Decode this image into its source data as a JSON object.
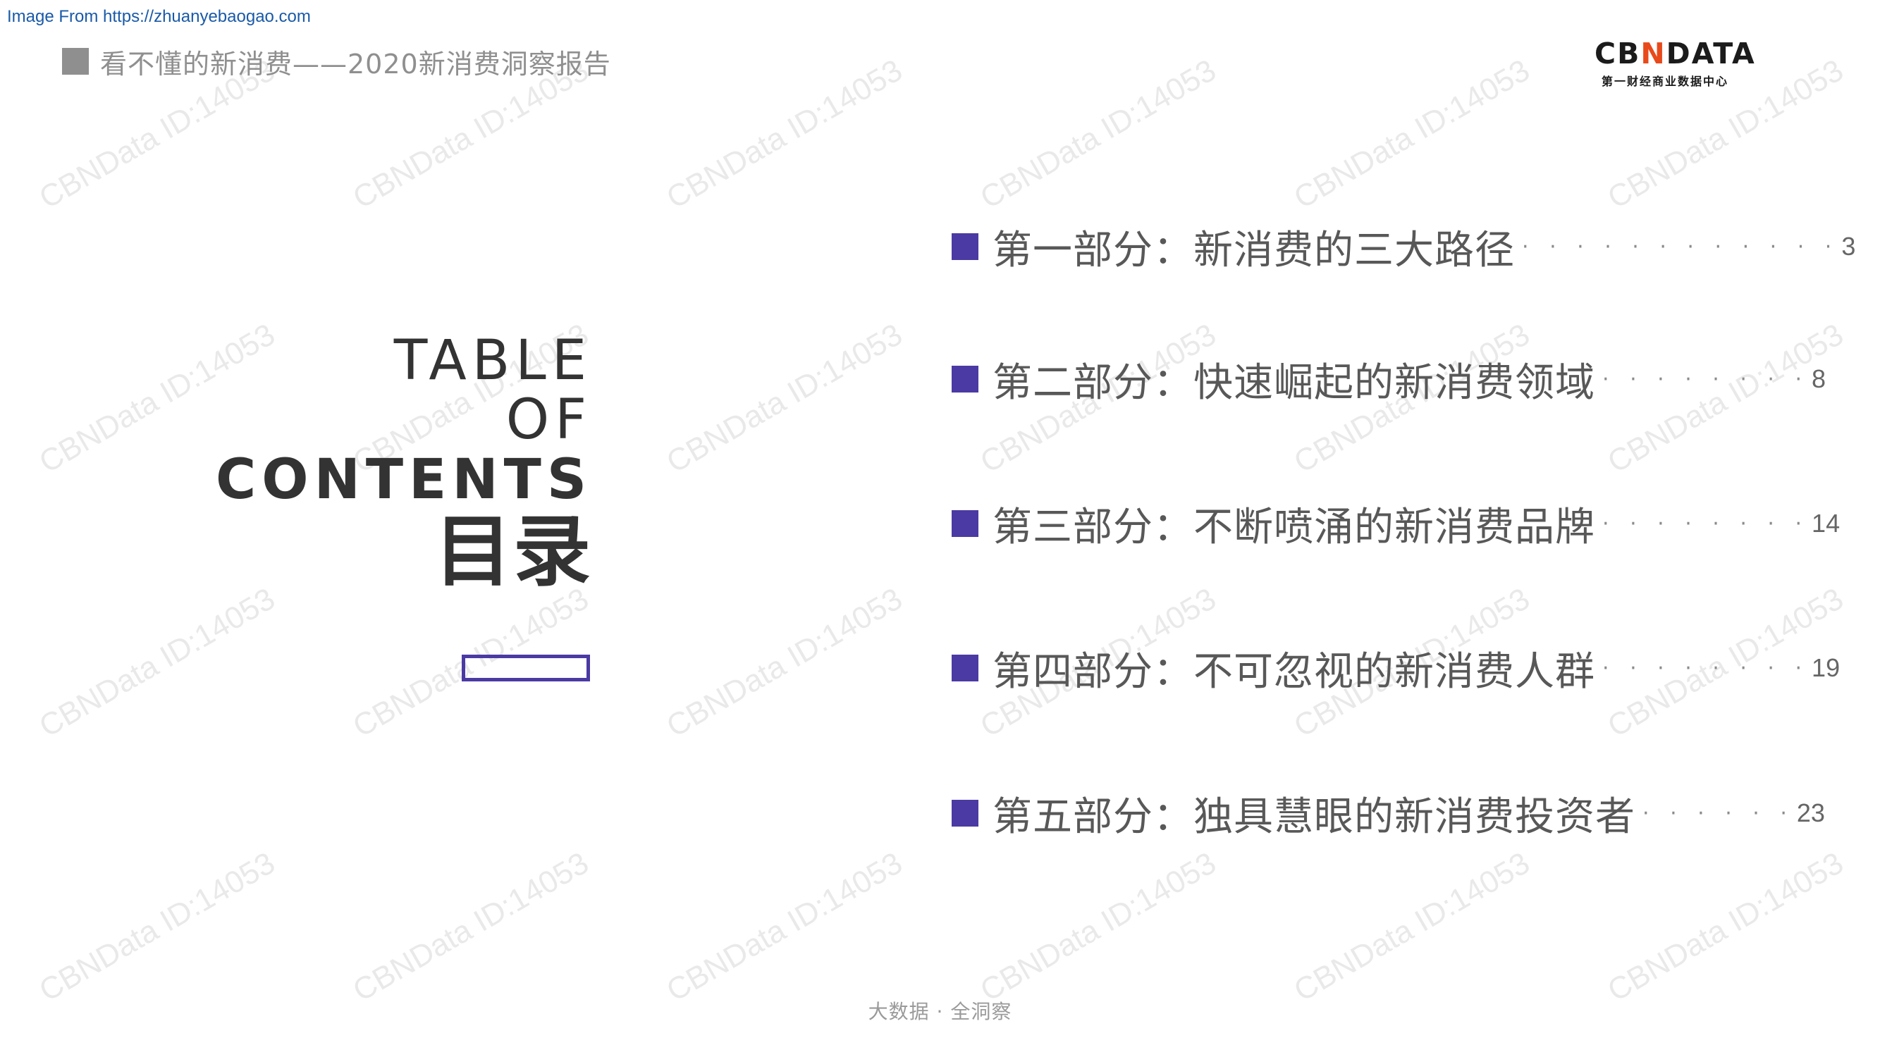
{
  "source_link": "Image From https://zhuanyebaogao.com",
  "header": {
    "title": "看不懂的新消费——2020新消费洞察报告"
  },
  "logo": {
    "main_pre": "CB",
    "main_n": "N",
    "main_post": "DATA",
    "sub": "第一财经商业数据中心"
  },
  "toc_heading": {
    "line1": "TABLE",
    "line2": "OF",
    "line3": "CONTENTS",
    "line4": "目录"
  },
  "toc_items": [
    {
      "label": "第一部分：新消费的三大路径",
      "dots": "· · · · · · · · · · · ·",
      "page": "3"
    },
    {
      "label": "第二部分：快速崛起的新消费领域",
      "dots": "· · · · · · · ·",
      "page": "8"
    },
    {
      "label": "第三部分：不断喷涌的新消费品牌",
      "dots": "· · · · · · · ·",
      "page": "14"
    },
    {
      "label": "第四部分：不可忽视的新消费人群",
      "dots": "· · · · · · · ·",
      "page": "19"
    },
    {
      "label": "第五部分：独具慧眼的新消费投资者",
      "dots": "· · · · · ·",
      "page": "23"
    }
  ],
  "footer": {
    "text": "大数据 · 全洞察"
  },
  "watermark": {
    "text": "CBNData ID:14053"
  },
  "colors": {
    "accent": "#4b3aa3",
    "header_gray": "#8f8f8f",
    "logo_orange": "#e84a1b"
  }
}
